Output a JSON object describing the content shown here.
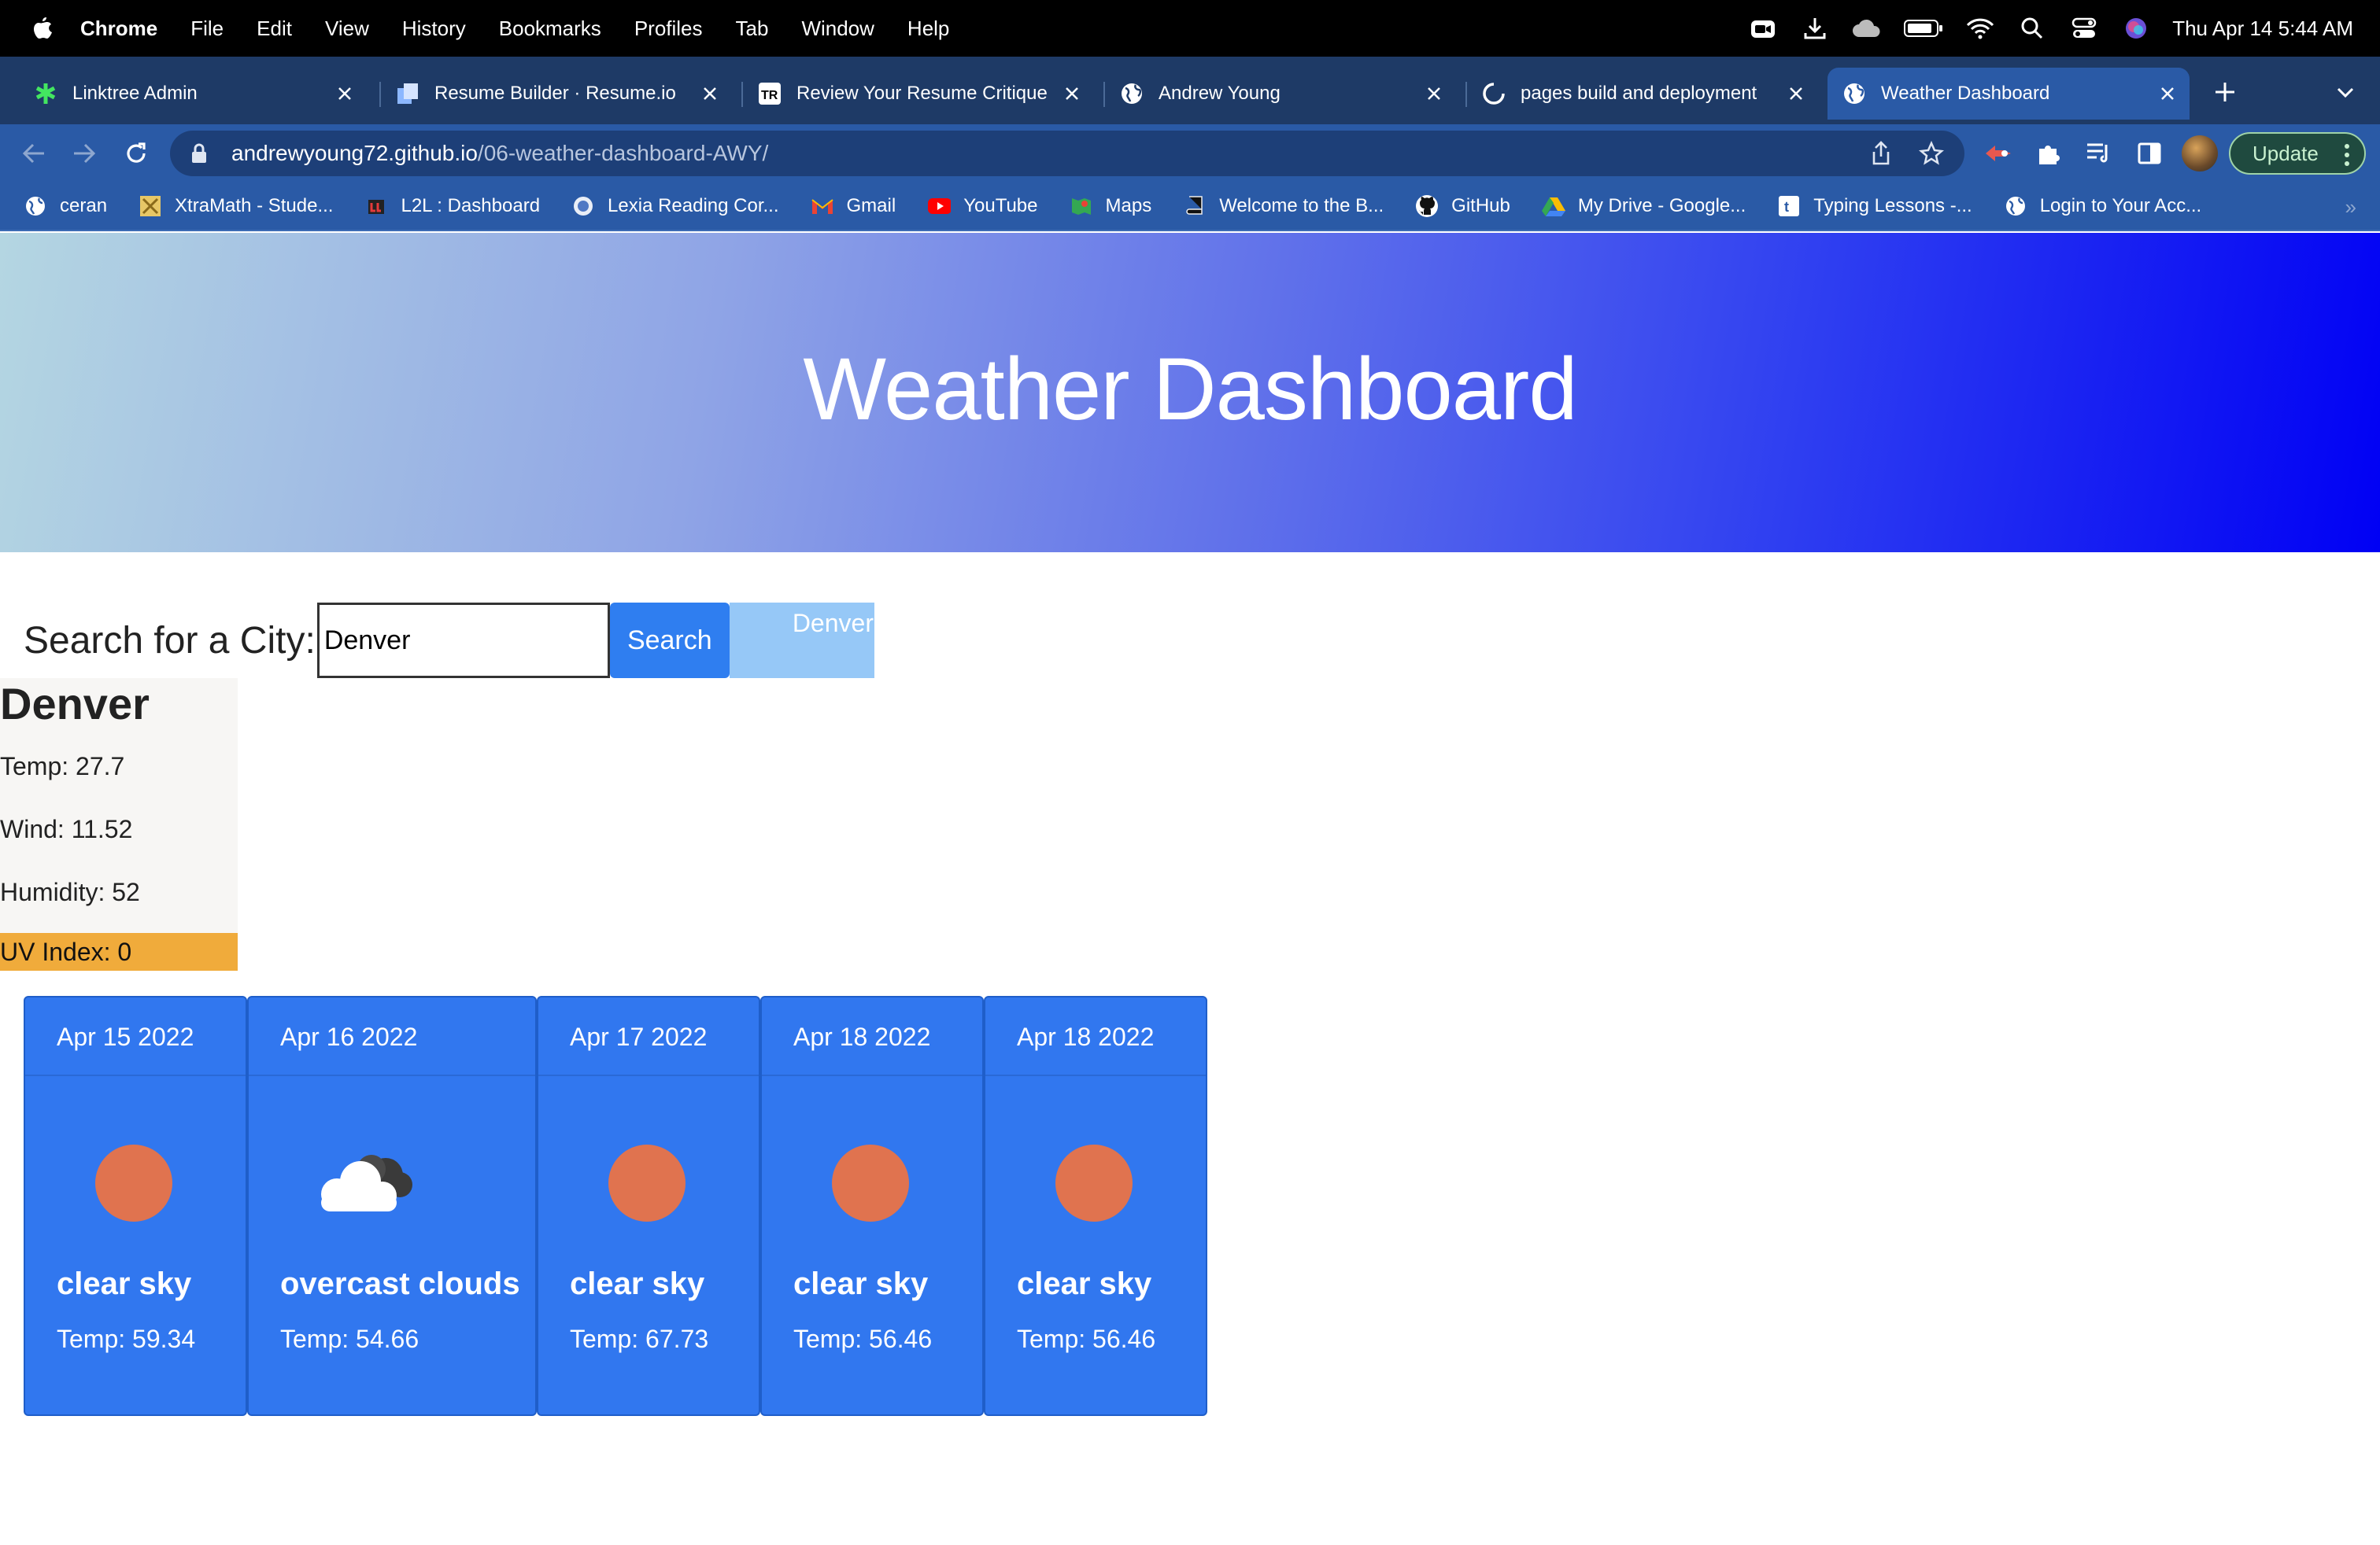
{
  "menubar": {
    "app_name": "Chrome",
    "items": [
      "File",
      "Edit",
      "View",
      "History",
      "Bookmarks",
      "Profiles",
      "Tab",
      "Window",
      "Help"
    ],
    "clock": "Thu Apr 14  5:44 AM"
  },
  "tabs": [
    {
      "title": "Linktree Admin",
      "icon": "linktree-icon",
      "active": false
    },
    {
      "title": "Resume Builder · Resume.io",
      "icon": "resume-io-icon",
      "active": false
    },
    {
      "title": "Review Your Resume Critique",
      "icon": "tr-icon",
      "active": false
    },
    {
      "title": "Andrew Young",
      "icon": "globe-icon",
      "active": false
    },
    {
      "title": "pages build and deployment",
      "icon": "github-loading-icon",
      "active": false
    },
    {
      "title": "Weather Dashboard",
      "icon": "globe-icon",
      "active": true
    }
  ],
  "address_bar": {
    "host": "andrewyoung72.github.io",
    "path": "/06-weather-dashboard-AWY/"
  },
  "update_button": "Update",
  "bookmarks": [
    {
      "label": "ceran",
      "icon": "globe-icon"
    },
    {
      "label": "XtraMath - Stude...",
      "icon": "xtramath-icon"
    },
    {
      "label": "L2L : Dashboard",
      "icon": "l2l-icon"
    },
    {
      "label": "Lexia Reading Cor...",
      "icon": "lexia-icon"
    },
    {
      "label": "Gmail",
      "icon": "gmail-icon"
    },
    {
      "label": "YouTube",
      "icon": "youtube-icon"
    },
    {
      "label": "Maps",
      "icon": "maps-icon"
    },
    {
      "label": "Welcome to the B...",
      "icon": "book-icon"
    },
    {
      "label": "GitHub",
      "icon": "github-icon"
    },
    {
      "label": "My Drive - Google...",
      "icon": "drive-icon"
    },
    {
      "label": "Typing Lessons -...",
      "icon": "typing-icon"
    },
    {
      "label": "Login to Your Acc...",
      "icon": "globe-icon"
    }
  ],
  "colors": {
    "tab_strip": "#1e3a66",
    "toolbar": "#2a5aa6",
    "hero_start": "#b4d6e2",
    "hero_end": "#0000f4",
    "accent_button": "#2f7ef0",
    "history_button": "#96c8f7",
    "uv_low": "#f0ab3b",
    "forecast_card": "#3177ef",
    "sun": "#e0734f"
  },
  "page": {
    "title": "Weather Dashboard",
    "search": {
      "label": "Search for a City:",
      "value": "Denver",
      "button": "Search",
      "history": [
        "Denver"
      ]
    },
    "current": {
      "city": "Denver",
      "temp": "Temp: 27.7",
      "wind": "Wind: 11.52",
      "humidity": "Humidity: 52",
      "uv": "UV Index: 0"
    },
    "forecast": [
      {
        "date": "Apr 15 2022",
        "icon": "sun-icon",
        "desc": "clear sky",
        "temp": "Temp: 59.34"
      },
      {
        "date": "Apr 16 2022",
        "icon": "cloud-icon",
        "desc": "overcast clouds",
        "temp": "Temp: 54.66"
      },
      {
        "date": "Apr 17 2022",
        "icon": "sun-icon",
        "desc": "clear sky",
        "temp": "Temp: 67.73"
      },
      {
        "date": "Apr 18 2022",
        "icon": "sun-icon",
        "desc": "clear sky",
        "temp": "Temp: 56.46"
      },
      {
        "date": "Apr 18 2022",
        "icon": "sun-icon",
        "desc": "clear sky",
        "temp": "Temp: 56.46"
      }
    ]
  }
}
